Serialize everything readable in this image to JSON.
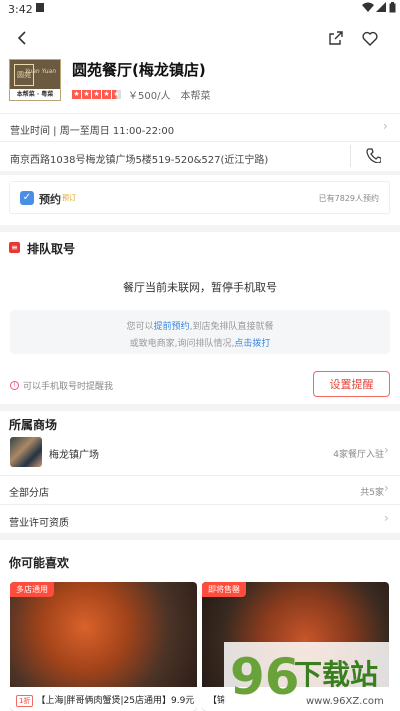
{
  "status": {
    "time": "3:42"
  },
  "restaurant": {
    "name": "圆苑餐厅(梅龙镇店)",
    "logo_caption": "本帮菜 · 粤菜",
    "logo_word": "Yuan Yuan",
    "logo_char": "圆苑",
    "rating": 4.5,
    "price": "￥500/人",
    "cuisine": "本帮菜"
  },
  "hours": "营业时间 | 周一至周日 11:00-22:00",
  "address": "南京西路1038号梅龙镇广场5楼519-520&527(近江宁路)",
  "booking": {
    "label": "预约",
    "badge": "预订",
    "count_text": "已有7829人预约"
  },
  "queue": {
    "title": "排队取号",
    "notice": "餐厅当前未联网，暂停手机取号",
    "box_line1_pre": "您可以",
    "box_line1_link": "提前预约",
    "box_line1_post": ",到店免排队直接就餐",
    "box_line2_pre": "或致电商家,询问排队情况,",
    "box_line2_link": "点击拨打",
    "remind_hint": "可以手机取号时提醒我",
    "remind_button": "设置提醒"
  },
  "mall": {
    "title": "所属商场",
    "name": "梅龙镇广场",
    "count": "4家餐厅入驻"
  },
  "branches": {
    "label": "全部分店",
    "count": "共5家"
  },
  "license": {
    "label": "营业许可资质"
  },
  "recommend": {
    "title": "你可能喜欢",
    "cards": [
      {
        "tag": "多店通用",
        "discount": "1折",
        "caption": "【上海|胖哥俩肉蟹煲|25店通用】9.9元"
      },
      {
        "tag": "即将售罄",
        "discount": "",
        "caption": "【锦"
      }
    ]
  },
  "watermark": {
    "digits": "96",
    "text": "下载站",
    "url": "www.96XZ.com"
  }
}
